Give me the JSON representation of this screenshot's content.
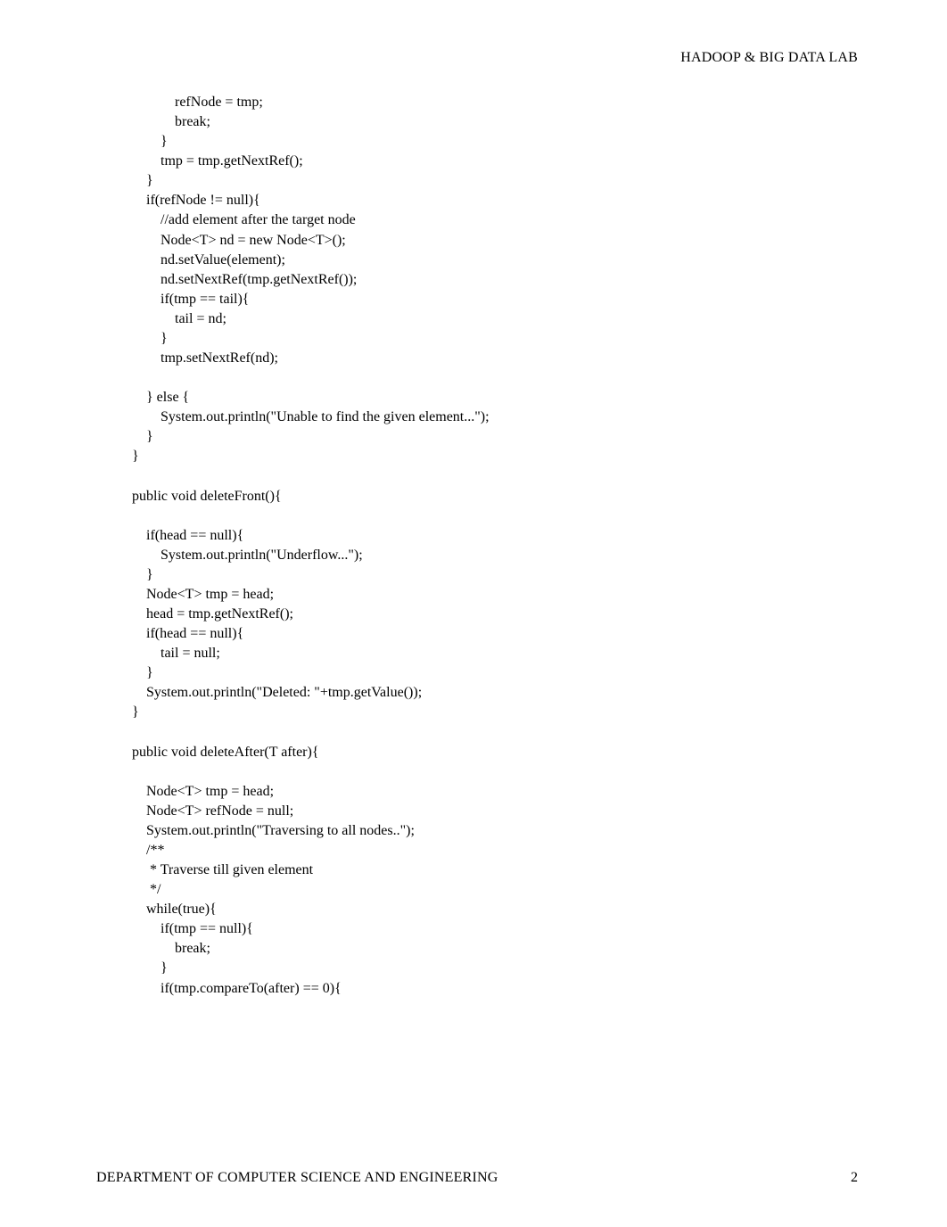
{
  "header": "HADOOP & BIG DATA LAB",
  "code": "            refNode = tmp;\n            break;\n        }\n        tmp = tmp.getNextRef();\n    }\n    if(refNode != null){\n        //add element after the target node\n        Node<T> nd = new Node<T>();\n        nd.setValue(element);\n        nd.setNextRef(tmp.getNextRef());\n        if(tmp == tail){\n            tail = nd;\n        }\n        tmp.setNextRef(nd);\n\n    } else {\n        System.out.println(\"Unable to find the given element...\");\n    }\n}\n\npublic void deleteFront(){\n\n    if(head == null){\n        System.out.println(\"Underflow...\");\n    }\n    Node<T> tmp = head;\n    head = tmp.getNextRef();\n    if(head == null){\n        tail = null;\n    }\n    System.out.println(\"Deleted: \"+tmp.getValue());\n}\n\npublic void deleteAfter(T after){\n\n    Node<T> tmp = head;\n    Node<T> refNode = null;\n    System.out.println(\"Traversing to all nodes..\");\n    /**\n     * Traverse till given element\n     */\n    while(true){\n        if(tmp == null){\n            break;\n        }\n        if(tmp.compareTo(after) == 0){",
  "footer": {
    "left": "DEPARTMENT OF COMPUTER SCIENCE AND ENGINEERING",
    "right": "2"
  }
}
